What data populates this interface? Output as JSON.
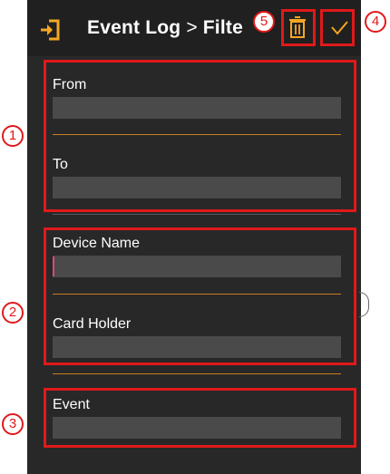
{
  "appbar": {
    "title": "Event Log",
    "separator": ">",
    "subtitle": "Filte"
  },
  "filters": {
    "from_label": "From",
    "from_value": "",
    "to_label": "To",
    "to_value": "",
    "device_label": "Device Name",
    "device_value": "",
    "cardholder_label": "Card Holder",
    "cardholder_value": "",
    "event_label": "Event",
    "event_value": ""
  },
  "annotations": {
    "n1": "1",
    "n2": "2",
    "n3": "3",
    "n4": "4",
    "n5": "5"
  },
  "colors": {
    "background": "#282828",
    "appbar": "#202020",
    "accent": "#f5a623",
    "divider": "#c77d22",
    "input": "#4a4a4a",
    "annotation": "#e0191a"
  },
  "icons": {
    "back": "exit-icon",
    "delete": "trash-icon",
    "confirm": "check-icon"
  }
}
